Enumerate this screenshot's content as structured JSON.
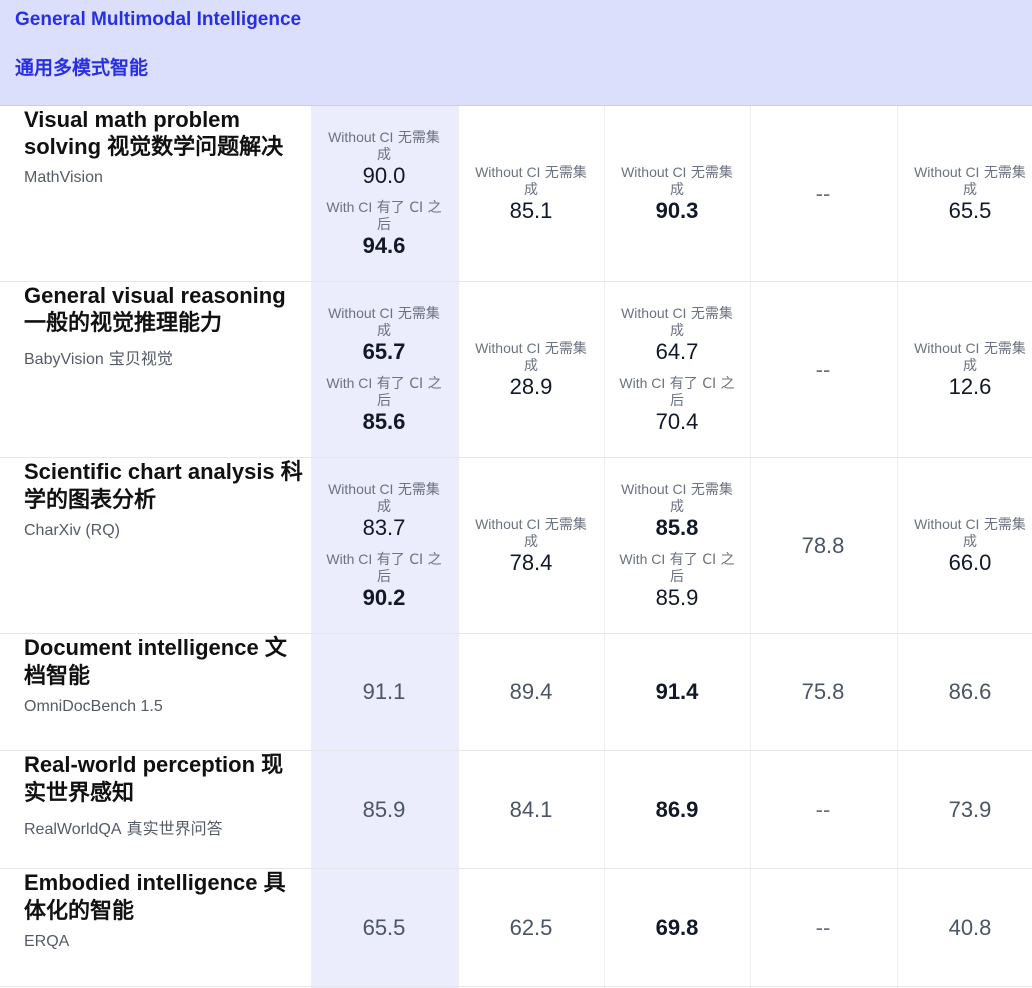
{
  "section": {
    "title_en": "General Multimodal Intelligence",
    "title_zh": "通用多模式智能"
  },
  "labels": {
    "without_ci_en": "Without CI",
    "without_ci_zh": "无需集成",
    "with_ci_en": "With CI",
    "with_ci_zh": "有了 CI 之后",
    "dash": "--"
  },
  "rows": [
    {
      "task_en": "Visual math problem solving",
      "task_zh": "视觉数学问题解决",
      "bench_en": "MathVision",
      "bench_zh": "",
      "cols": [
        {
          "type": "dual",
          "without": "90.0",
          "with": "94.6",
          "without_bold": false,
          "with_bold": true
        },
        {
          "type": "without",
          "without": "85.1",
          "without_bold": false
        },
        {
          "type": "without",
          "without": "90.3",
          "without_bold": true
        },
        {
          "type": "dash"
        },
        {
          "type": "without",
          "without": "65.5",
          "without_bold": false
        }
      ]
    },
    {
      "task_en": "General visual reasoning",
      "task_zh": "一般的视觉推理能力",
      "bench_en": "BabyVision",
      "bench_zh": "宝贝视觉",
      "cols": [
        {
          "type": "dual",
          "without": "65.7",
          "with": "85.6",
          "without_bold": true,
          "with_bold": true
        },
        {
          "type": "without",
          "without": "28.9",
          "without_bold": false
        },
        {
          "type": "dual",
          "without": "64.7",
          "with": "70.4",
          "without_bold": false,
          "with_bold": false
        },
        {
          "type": "dash"
        },
        {
          "type": "without",
          "without": "12.6",
          "without_bold": false
        }
      ]
    },
    {
      "task_en": "Scientific chart analysis",
      "task_zh": "科学的图表分析",
      "bench_en": "CharXiv (RQ)",
      "bench_zh": "",
      "cols": [
        {
          "type": "dual",
          "without": "83.7",
          "with": "90.2",
          "without_bold": false,
          "with_bold": true
        },
        {
          "type": "without",
          "without": "78.4",
          "without_bold": false
        },
        {
          "type": "dual",
          "without": "85.8",
          "with": "85.9",
          "without_bold": true,
          "with_bold": false
        },
        {
          "type": "single",
          "value": "78.8",
          "bold": false
        },
        {
          "type": "without",
          "without": "66.0",
          "without_bold": false
        }
      ]
    },
    {
      "task_en": "Document intelligence",
      "task_zh": "文档智能",
      "bench_en": "OmniDocBench 1.5",
      "bench_zh": "",
      "cols": [
        {
          "type": "single",
          "value": "91.1",
          "bold": false
        },
        {
          "type": "single",
          "value": "89.4",
          "bold": false
        },
        {
          "type": "single",
          "value": "91.4",
          "bold": true
        },
        {
          "type": "single",
          "value": "75.8",
          "bold": false
        },
        {
          "type": "single",
          "value": "86.6",
          "bold": false
        }
      ]
    },
    {
      "task_en": "Real-world perception",
      "task_zh": "现实世界感知",
      "bench_en": "RealWorldQA",
      "bench_zh": "真实世界问答",
      "cols": [
        {
          "type": "single",
          "value": "85.9",
          "bold": false
        },
        {
          "type": "single",
          "value": "84.1",
          "bold": false
        },
        {
          "type": "single",
          "value": "86.9",
          "bold": true
        },
        {
          "type": "dash"
        },
        {
          "type": "single",
          "value": "73.9",
          "bold": false
        }
      ]
    },
    {
      "task_en": "Embodied intelligence",
      "task_zh": "具体化的智能",
      "bench_en": "ERQA",
      "bench_zh": "",
      "cols": [
        {
          "type": "single",
          "value": "65.5",
          "bold": false
        },
        {
          "type": "single",
          "value": "62.5",
          "bold": false
        },
        {
          "type": "single",
          "value": "69.8",
          "bold": true
        },
        {
          "type": "dash"
        },
        {
          "type": "single",
          "value": "40.8",
          "bold": false
        }
      ]
    }
  ]
}
